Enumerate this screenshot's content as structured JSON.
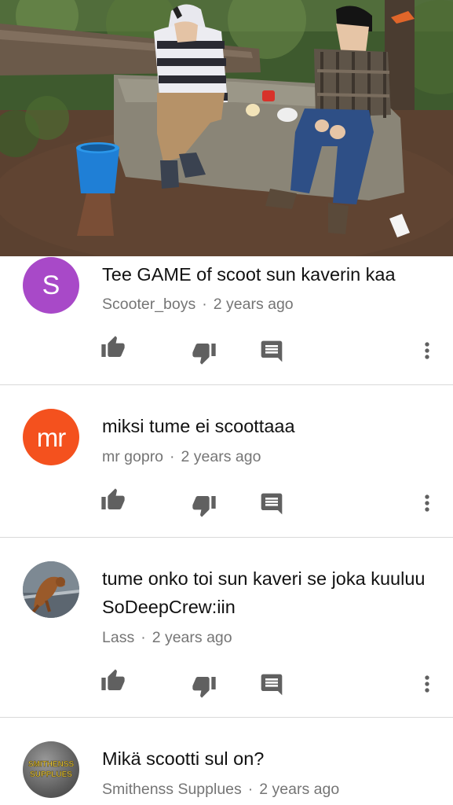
{
  "video": {
    "description_icon": "video-thumbnail"
  },
  "comments": [
    {
      "avatar_letter": "S",
      "avatar_color": "#a849c8",
      "text": "Tee GAME of scoot sun kaverin kaa",
      "author": "Scooter_boys",
      "separator": "·",
      "time": "2 years ago"
    },
    {
      "avatar_letter": "mr",
      "avatar_color": "#f4511e",
      "text": "miksi tume ei scoottaaa",
      "author": "mr gopro",
      "separator": "·",
      "time": "2 years ago"
    },
    {
      "avatar_letter": "",
      "avatar_color": "#6f7c86",
      "text": "tume onko toi sun kaveri se joka kuuluu SoDeepCrew:iin",
      "author": "Lass",
      "separator": "·",
      "time": "2 years ago"
    },
    {
      "avatar_logo_text": "SMITHENSS SUPPLUES",
      "avatar_color": "#6a6a6a",
      "text": "Mikä scootti sul on?",
      "author": "Smithenss Supplues",
      "separator": "·",
      "time": "2 years ago"
    }
  ],
  "icons": {
    "like": "thumbs-up-icon",
    "dislike": "thumbs-down-icon",
    "reply": "reply-icon",
    "more": "more-vert-icon"
  }
}
